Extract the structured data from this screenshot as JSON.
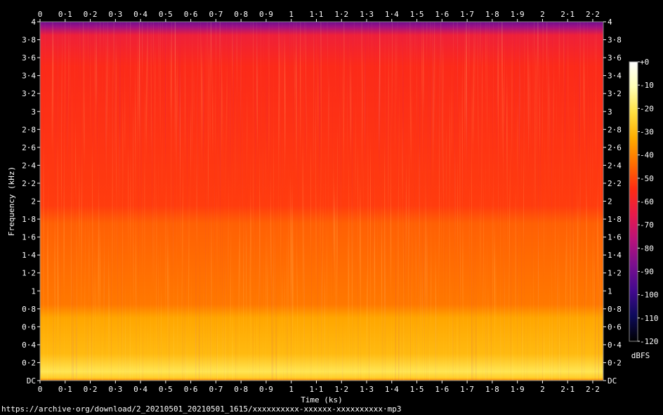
{
  "chart_data": {
    "type": "heatmap",
    "subtype": "spectrogram",
    "xlabel": "Time (ks)",
    "ylabel": "Frequency (kHz)",
    "x_ticks": [
      "0",
      "0·1",
      "0·2",
      "0·3",
      "0·4",
      "0·5",
      "0·6",
      "0·7",
      "0·8",
      "0·9",
      "1",
      "1·1",
      "1·2",
      "1·3",
      "1·4",
      "1·5",
      "1·6",
      "1·7",
      "1·8",
      "1·9",
      "2",
      "2·1",
      "2·2"
    ],
    "y_ticks": [
      "DC",
      "0·2",
      "0·4",
      "0·6",
      "0·8",
      "1",
      "1·2",
      "1·4",
      "1·6",
      "1·8",
      "2",
      "2·2",
      "2·4",
      "2·6",
      "2·8",
      "3",
      "3·2",
      "3·4",
      "3·6",
      "3·8",
      "4"
    ],
    "xlim": [
      0,
      2.242
    ],
    "ylim": [
      0,
      4
    ],
    "colorbar": {
      "label": "dBFS",
      "ticks": [
        "+0",
        "-10",
        "-20",
        "-30",
        "-40",
        "-50",
        "-60",
        "-70",
        "-80",
        "-90",
        "-100",
        "-110",
        "-120"
      ],
      "range": [
        -120,
        0
      ],
      "colors": [
        "#000000",
        "#0d0a5a",
        "#43098f",
        "#7a0f8f",
        "#b8127b",
        "#e81a4a",
        "#ff2c12",
        "#ff6f00",
        "#ffad00",
        "#ffe040",
        "#ffffb4",
        "#ffffff"
      ]
    },
    "levels": {
      "low_band_0_to_0.2kHz": -20,
      "band_0.2_to_0.8kHz": -30,
      "band_0.8_to_1.8kHz": -42,
      "band_1.8_to_3.9kHz": -52,
      "above_3.9kHz": -80
    }
  },
  "footer": {
    "url": "https://archive·org/download/2_20210501_20210501_1615/xxxxxxxxxx-xxxxxx-xxxxxxxxxx·mp3"
  }
}
